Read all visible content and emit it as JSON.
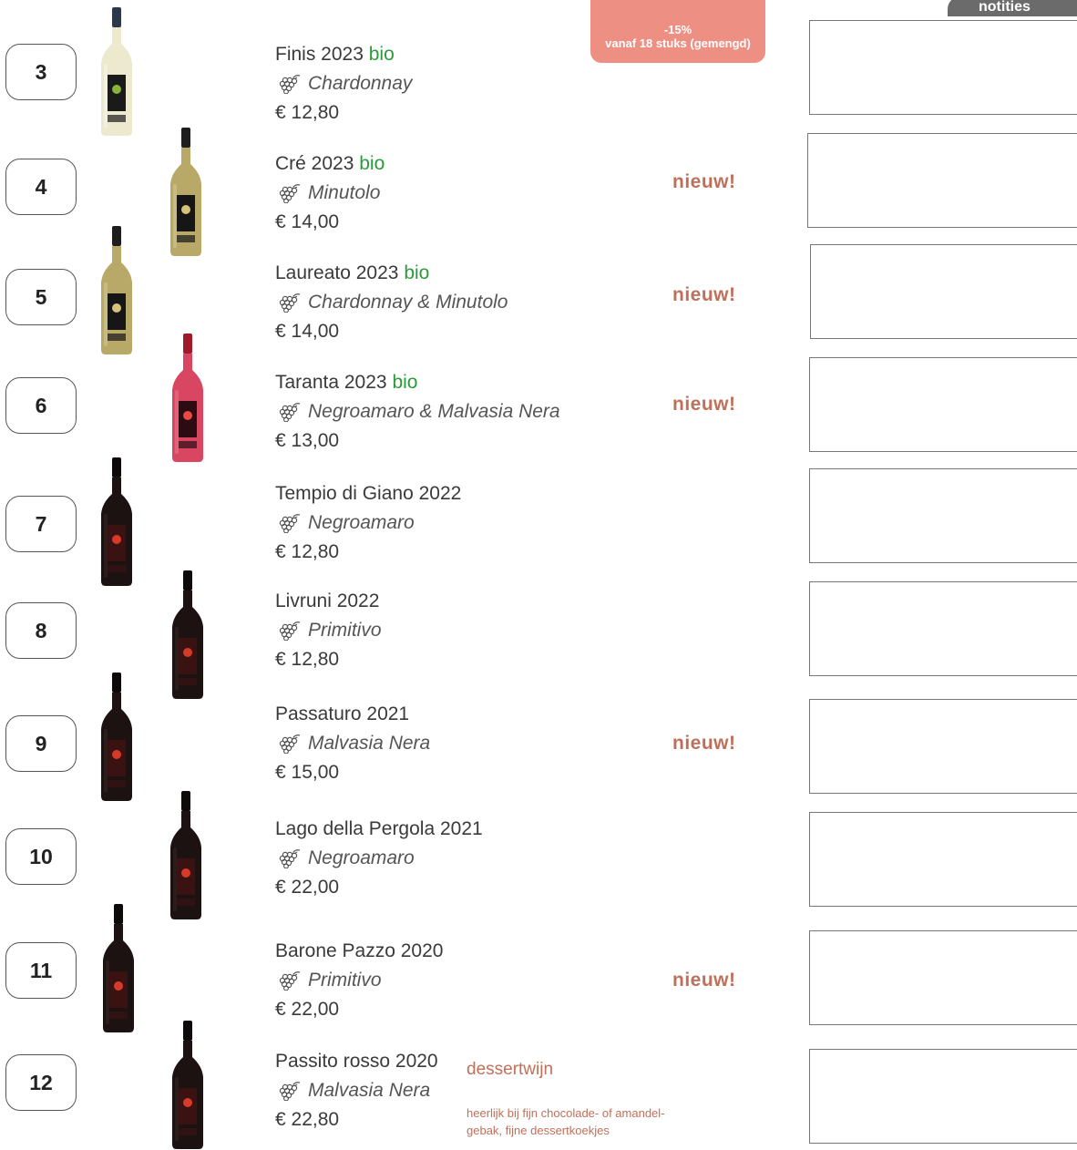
{
  "promo": {
    "discount": "-15%",
    "condition": "vanaf 18 stuks (gemengd)"
  },
  "notes_tab_label": "notities",
  "badge_new": "nieuw!",
  "bio_label": "bio",
  "colors": {
    "bio": "#2a9a3a",
    "accent": "#c0705a",
    "promo": "#ee8f84",
    "tab": "#6b6b6b"
  },
  "wines": [
    {
      "number": "3",
      "name": "Finis 2023",
      "bio": true,
      "grape": "Chardonnay",
      "price": "€ 12,80",
      "new": false,
      "bottle": "white"
    },
    {
      "number": "4",
      "name": "Cré 2023",
      "bio": true,
      "grape": "Minutolo",
      "price": "€ 14,00",
      "new": true,
      "bottle": "amber"
    },
    {
      "number": "5",
      "name": "Laureato 2023",
      "bio": true,
      "grape": "Chardonnay & Minutolo",
      "price": "€ 14,00",
      "new": true,
      "bottle": "amber"
    },
    {
      "number": "6",
      "name": "Taranta 2023",
      "bio": true,
      "grape": "Negroamaro & Malvasia Nera",
      "price": "€ 13,00",
      "new": true,
      "bottle": "rose"
    },
    {
      "number": "7",
      "name": "Tempio di Giano 2022",
      "bio": false,
      "grape": "Negroamaro",
      "price": "€ 12,80",
      "new": false,
      "bottle": "red"
    },
    {
      "number": "8",
      "name": "Livruni 2022",
      "bio": false,
      "grape": "Primitivo",
      "price": "€ 12,80",
      "new": false,
      "bottle": "red"
    },
    {
      "number": "9",
      "name": "Passaturo 2021",
      "bio": false,
      "grape": "Malvasia Nera",
      "price": "€ 15,00",
      "new": true,
      "bottle": "red"
    },
    {
      "number": "10",
      "name": "Lago della Pergola 2021",
      "bio": false,
      "grape": "Negroamaro",
      "price": "€ 22,00",
      "new": false,
      "bottle": "red"
    },
    {
      "number": "11",
      "name": "Barone Pazzo 2020",
      "bio": false,
      "grape": "Primitivo",
      "price": "€ 22,00",
      "new": true,
      "bottle": "red"
    },
    {
      "number": "12",
      "name": "Passito rosso 2020",
      "bio": false,
      "grape": "Malvasia Nera",
      "price": "€ 22,80",
      "new": false,
      "bottle": "red"
    }
  ],
  "dessert": {
    "label": "dessertwijn",
    "description_line1": "heerlijk bij fijn chocolade- of amandel-",
    "description_line2": "gebak, fijne dessertkoekjes"
  }
}
